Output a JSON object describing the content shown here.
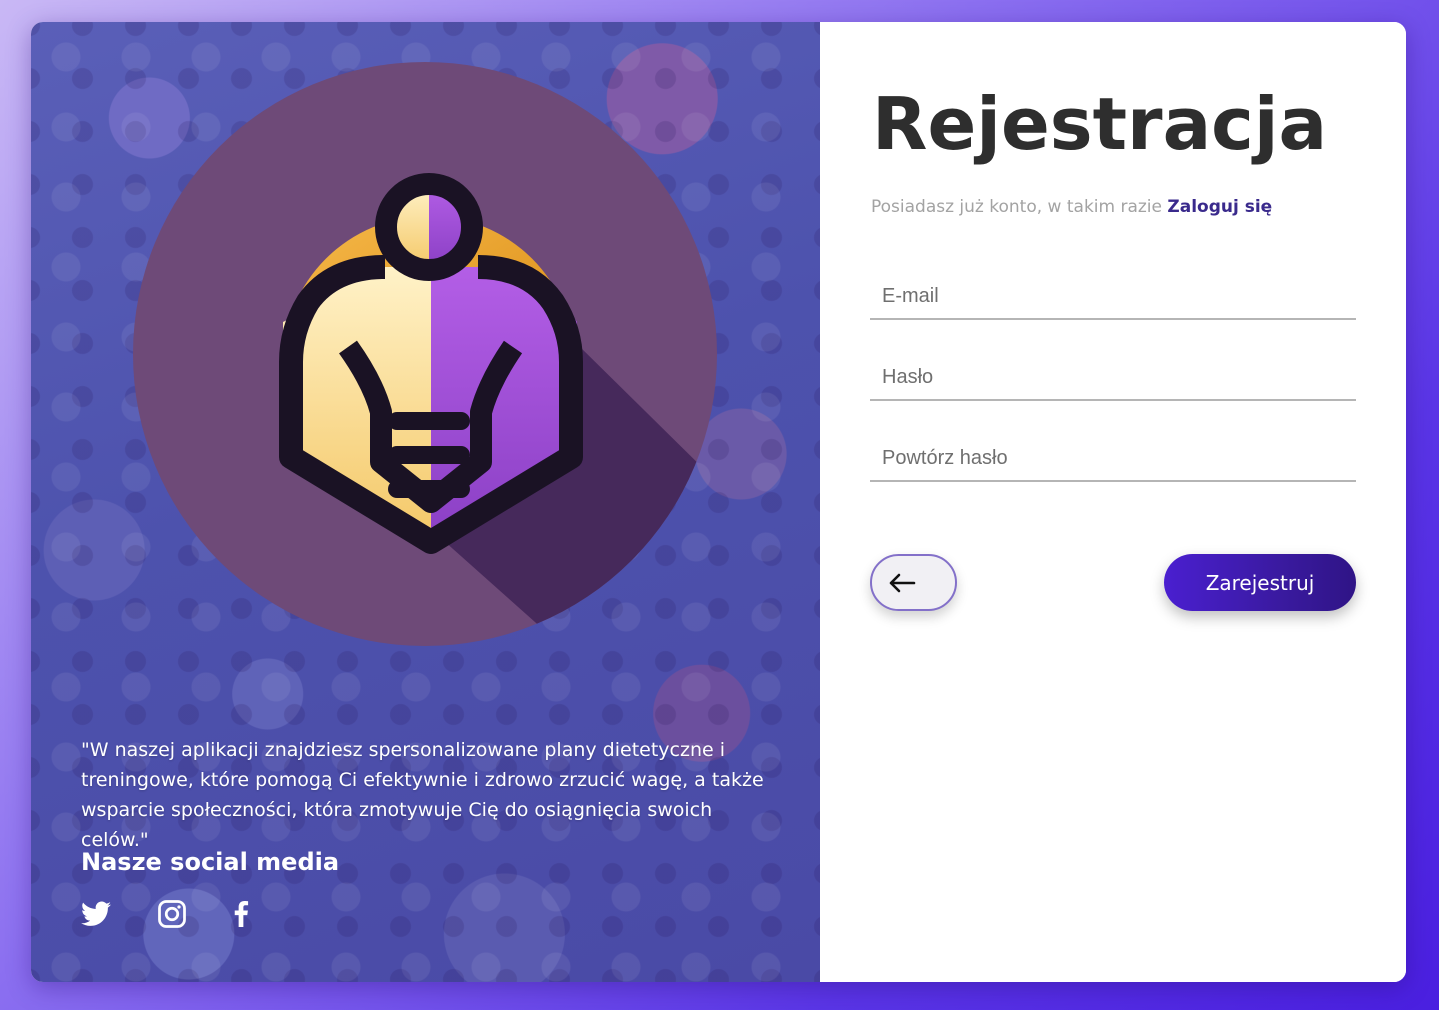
{
  "quote": "\"W naszej aplikacji znajdziesz spersonalizowane plany dietetyczne i treningowe, które pomogą Ci efektywnie i zdrowo zrzucić wagę, a także wsparcie społeczności, która zmotywuje Cię do osiągnięcia swoich celów.\"",
  "social": {
    "title": "Nasze social media",
    "icons": [
      "twitter-icon",
      "instagram-icon",
      "facebook-icon"
    ]
  },
  "form": {
    "title": "Rejestracja",
    "subtitle_text": "Posiadasz już konto, w takim razie ",
    "login_link": "Zaloguj się",
    "email_placeholder": "E-mail",
    "password_placeholder": "Hasło",
    "repeat_password_placeholder": "Powtórz hasło",
    "submit_label": "Zarejestruj",
    "back_icon": "arrow-left-icon"
  },
  "colors": {
    "accent": "#3a1aa0",
    "link": "#3a2a8c",
    "logo_gold": "#f2a93b",
    "logo_purple": "#9b4fd6",
    "logo_circle": "#6e4a78"
  }
}
